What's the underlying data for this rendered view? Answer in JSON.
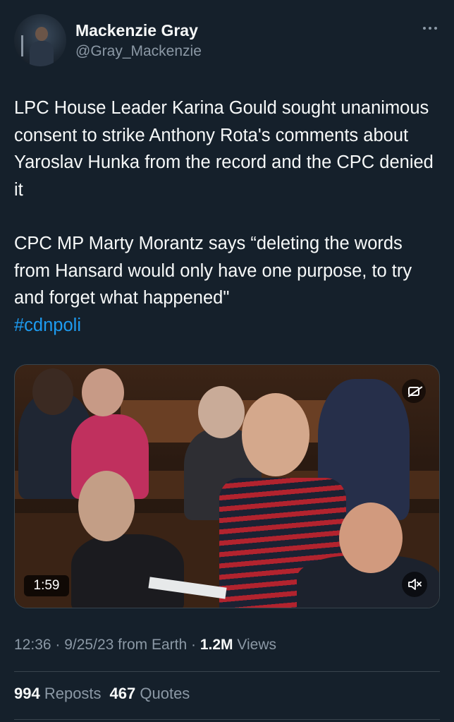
{
  "author": {
    "name": "Mackenzie Gray",
    "handle": "@Gray_Mackenzie"
  },
  "tweet": {
    "paragraph1": "LPC House Leader Karina Gould sought unanimous consent to strike Anthony Rota's comments about Yaroslav Hunka from the record and the CPC denied it",
    "paragraph2": "CPC MP Marty Morantz says “deleting the words from Hansard would only have one purpose, to try and forget what happened\"",
    "hashtag": "#cdnpoli"
  },
  "media": {
    "duration": "1:59",
    "captions_icon": "captions-off-icon",
    "mute_icon": "speaker-muted-icon"
  },
  "meta": {
    "time": "12:36",
    "separator1": " · ",
    "date": "9/25/23",
    "source": " from Earth",
    "separator2": " · ",
    "views_count": "1.2M",
    "views_label": " Views"
  },
  "stats": {
    "reposts_count": "994",
    "reposts_label": " Reposts",
    "quotes_count": "467",
    "quotes_label": " Quotes"
  },
  "colors": {
    "background": "#15202b",
    "text": "#f7f9f9",
    "secondary": "#8b98a5",
    "link": "#1d9bf0",
    "divider": "#38444d"
  }
}
